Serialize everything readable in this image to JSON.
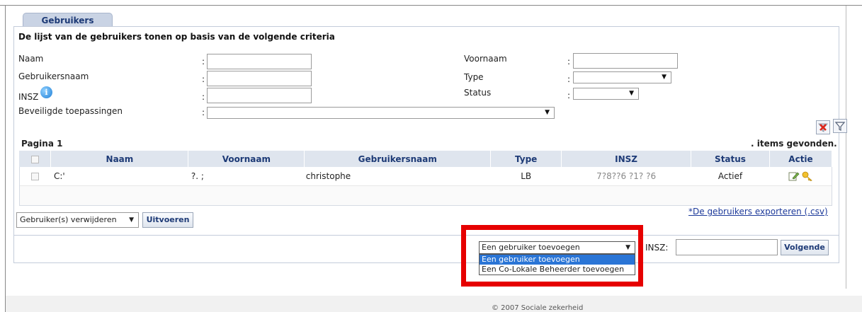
{
  "tab": {
    "label": "Gebruikers"
  },
  "criteria": {
    "title": "De lijst van de gebruikers tonen op basis van de volgende criteria",
    "naam_label": "Naam",
    "gebruikersnaam_label": "Gebruikersnaam",
    "insz_label": "INSZ",
    "beveiligde_label": "Beveiligde toepassingen",
    "voornaam_label": "Voornaam",
    "type_label": "Type",
    "status_label": "Status",
    "colon": ":"
  },
  "results": {
    "pagina": "Pagina 1",
    "items_found": ". items gevonden.",
    "columns": [
      "Naam",
      "Voornaam",
      "Gebruikersnaam",
      "Type",
      "INSZ",
      "Status",
      "Actie"
    ],
    "rows": [
      {
        "naam": "C:'",
        "voornaam": "?. ;",
        "gebruikersnaam": "christophe",
        "type": "LB",
        "insz": "7?8??6 ?1? ?6",
        "status": "Actief"
      }
    ]
  },
  "bulk": {
    "select_value": "Gebruiker(s) verwijderen",
    "execute_label": "Uitvoeren",
    "export_link": "*De gebruikers exporteren (.csv)"
  },
  "add": {
    "select_value": "Een gebruiker toevoegen",
    "options": [
      "Een gebruiker toevoegen",
      "Een Co-Lokale Beheerder toevoegen"
    ],
    "insz_label": "INSZ:",
    "next_label": "Volgende"
  },
  "footer": {
    "text": "© 2007 Sociale zekerheid"
  },
  "colors": {
    "highlight": "#e60000",
    "header_bg": "#dfe5ee",
    "tab_bg": "#c9d3e4",
    "accent": "#1d3a76"
  },
  "icons": {
    "info": "info-icon",
    "delete": "delete-filter-icon",
    "filter": "filter-icon",
    "edit": "edit-icon",
    "key": "key-icon",
    "dropdown": "chevron-down-icon"
  }
}
